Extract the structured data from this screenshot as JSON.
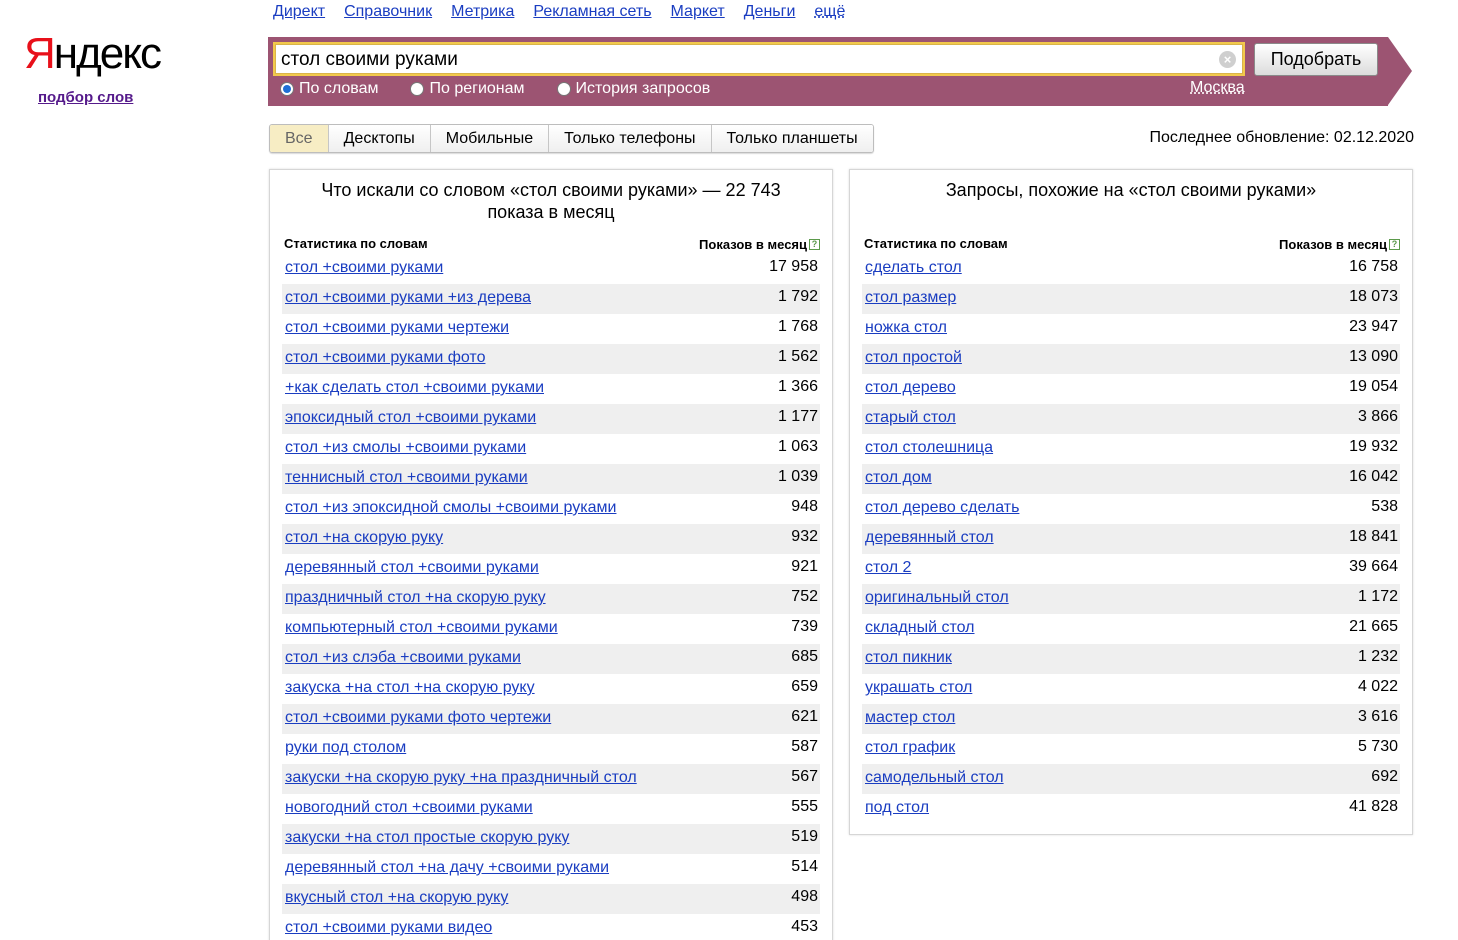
{
  "logo": {
    "text_ya": "Я",
    "text_rest": "ндекс",
    "subtitle": "подбор слов"
  },
  "topnav": [
    "Директ",
    "Справочник",
    "Метрика",
    "Рекламная сеть",
    "Маркет",
    "Деньги",
    "ещё"
  ],
  "search": {
    "value": "стол своими руками",
    "button": "Подобрать",
    "modes": [
      {
        "label": "По словам",
        "selected": true
      },
      {
        "label": "По регионам",
        "selected": false
      },
      {
        "label": "История запросов",
        "selected": false
      }
    ],
    "region": "Москва"
  },
  "tabs": [
    {
      "label": "Все",
      "active": true
    },
    {
      "label": "Десктопы",
      "active": false
    },
    {
      "label": "Мобильные",
      "active": false
    },
    {
      "label": "Только телефоны",
      "active": false
    },
    {
      "label": "Только планшеты",
      "active": false
    }
  ],
  "updated": "Последнее обновление: 02.12.2020",
  "left": {
    "title": "Что искали со словом «стол своими руками» — 22 743 показа в месяц",
    "col1": "Статистика по словам",
    "col2": "Показов в месяц",
    "rows": [
      [
        "стол +своими руками",
        "17 958"
      ],
      [
        "стол +своими руками +из дерева",
        "1 792"
      ],
      [
        "стол +своими руками чертежи",
        "1 768"
      ],
      [
        "стол +своими руками фото",
        "1 562"
      ],
      [
        "+как сделать стол +своими руками",
        "1 366"
      ],
      [
        "эпоксидный стол +своими руками",
        "1 177"
      ],
      [
        "стол +из смолы +своими руками",
        "1 063"
      ],
      [
        "теннисный стол +своими руками",
        "1 039"
      ],
      [
        "стол +из эпоксидной смолы +своими руками",
        "948"
      ],
      [
        "стол +на скорую руку",
        "932"
      ],
      [
        "деревянный стол +своими руками",
        "921"
      ],
      [
        "праздничный стол +на скорую руку",
        "752"
      ],
      [
        "компьютерный стол +своими руками",
        "739"
      ],
      [
        "стол +из слэба +своими руками",
        "685"
      ],
      [
        "закуска +на стол +на скорую руку",
        "659"
      ],
      [
        "стол +своими руками фото чертежи",
        "621"
      ],
      [
        "руки под столом",
        "587"
      ],
      [
        "закуски +на скорую руку +на праздничный стол",
        "567"
      ],
      [
        "новогодний стол +своими руками",
        "555"
      ],
      [
        "закуски +на стол простые скорую руку",
        "519"
      ],
      [
        "деревянный стол +на дачу +своими руками",
        "514"
      ],
      [
        "вкусный стол +на скорую руку",
        "498"
      ],
      [
        "стол +своими руками видео",
        "453"
      ]
    ]
  },
  "right": {
    "title": "Запросы, похожие на «стол своими руками»",
    "col1": "Статистика по словам",
    "col2": "Показов в месяц",
    "rows": [
      [
        "сделать стол",
        "16 758"
      ],
      [
        "стол размер",
        "18 073"
      ],
      [
        "ножка стол",
        "23 947"
      ],
      [
        "стол простой",
        "13 090"
      ],
      [
        "стол дерево",
        "19 054"
      ],
      [
        "старый стол",
        "3 866"
      ],
      [
        "стол столешница",
        "19 932"
      ],
      [
        "стол дом",
        "16 042"
      ],
      [
        "стол дерево сделать",
        "538"
      ],
      [
        "деревянный стол",
        "18 841"
      ],
      [
        "стол 2",
        "39 664"
      ],
      [
        "оригинальный стол",
        "1 172"
      ],
      [
        "складный стол",
        "21 665"
      ],
      [
        "стол пикник",
        "1 232"
      ],
      [
        "украшать стол",
        "4 022"
      ],
      [
        "мастер стол",
        "3 616"
      ],
      [
        "стол график",
        "5 730"
      ],
      [
        "самодельный стол",
        "692"
      ],
      [
        "под стол",
        "41 828"
      ]
    ]
  },
  "colors": {
    "band": "#9c5472",
    "link": "#1a3dc1",
    "logo_red": "#e8101a",
    "tab_active": "#f7edc4"
  }
}
